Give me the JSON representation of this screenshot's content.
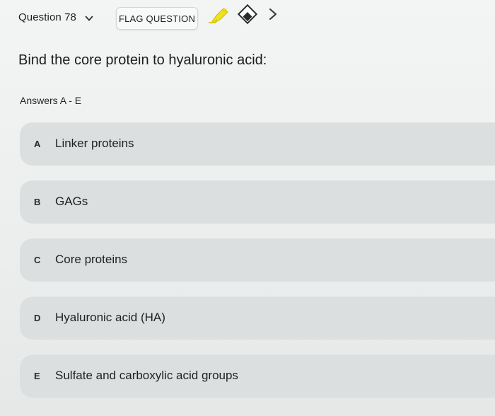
{
  "header": {
    "question_label": "Question 78",
    "flag_label": "FLAG QUESTION",
    "icons": {
      "question_dropdown": "chevron-down-icon",
      "highlighter": "highlighter-icon",
      "eraser": "eraser-icon",
      "next": "chevron-right-icon"
    }
  },
  "question": {
    "text": "Bind the core protein to hyaluronic acid:",
    "answers_hint": "Answers A - E"
  },
  "options": [
    {
      "letter": "A",
      "text": "Linker proteins"
    },
    {
      "letter": "B",
      "text": "GAGs"
    },
    {
      "letter": "C",
      "text": "Core proteins"
    },
    {
      "letter": "D",
      "text": "Hyaluronic acid (HA)"
    },
    {
      "letter": "E",
      "text": "Sulfate and carboxylic acid groups"
    }
  ],
  "colors": {
    "background": "#eef0f0",
    "option_background": "#dcdfdf",
    "highlighter_accent": "#f2e21c"
  }
}
